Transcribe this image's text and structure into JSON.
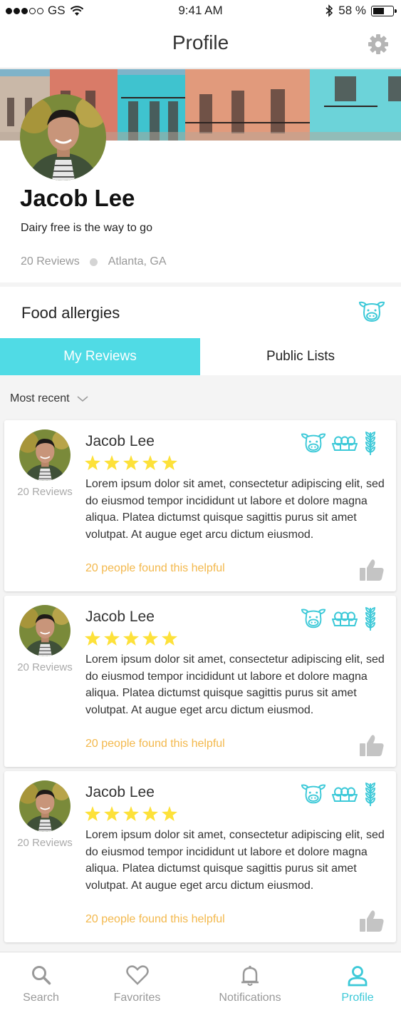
{
  "status_bar": {
    "carrier": "GS",
    "time": "9:41 AM",
    "battery": "58 %",
    "battery_level": 0.58
  },
  "nav": {
    "title": "Profile",
    "settings_icon": "gear-icon"
  },
  "profile": {
    "name": "Jacob Lee",
    "bio": "Dairy free is the way to go",
    "reviews_count": "20 Reviews",
    "location": "Atlanta, GA"
  },
  "allergies": {
    "title": "Food allergies",
    "icon": "cow-icon"
  },
  "tabs": {
    "my_reviews": "My Reviews",
    "public_lists": "Public Lists",
    "active": "my_reviews"
  },
  "sort": {
    "label": "Most recent"
  },
  "colors": {
    "accent": "#50dbe5",
    "icon_accent": "#3cc9d8",
    "star": "#fde13a",
    "helpful": "#f3b84c"
  },
  "reviews": [
    {
      "author": "Jacob Lee",
      "author_reviews": "20 Reviews",
      "rating": 5,
      "icons": [
        "cow-icon",
        "egg-carton-icon",
        "wheat-icon"
      ],
      "text": "Lorem ipsum dolor sit amet, consectetur adipiscing elit, sed do eiusmod tempor incididunt ut labore et dolore magna aliqua. Platea dictumst quisque sagittis purus sit amet volutpat. At augue eget arcu dictum eiusmod.",
      "helpful": "20 people found this helpful"
    },
    {
      "author": "Jacob Lee",
      "author_reviews": "20 Reviews",
      "rating": 5,
      "icons": [
        "cow-icon",
        "egg-carton-icon",
        "wheat-icon"
      ],
      "text": "Lorem ipsum dolor sit amet, consectetur adipiscing elit, sed do eiusmod tempor incididunt ut labore et dolore magna aliqua. Platea dictumst quisque sagittis purus sit amet volutpat. At augue eget arcu dictum eiusmod.",
      "helpful": "20 people found this helpful"
    },
    {
      "author": "Jacob Lee",
      "author_reviews": "20 Reviews",
      "rating": 5,
      "icons": [
        "cow-icon",
        "egg-carton-icon",
        "wheat-icon"
      ],
      "text": "Lorem ipsum dolor sit amet, consectetur adipiscing elit, sed do eiusmod tempor incididunt ut labore et dolore magna aliqua. Platea dictumst quisque sagittis purus sit amet volutpat. At augue eget arcu dictum eiusmod.",
      "helpful": "20 people found this helpful"
    }
  ],
  "tab_bar": {
    "items": [
      {
        "label": "Search",
        "icon": "search-icon"
      },
      {
        "label": "Favorites",
        "icon": "heart-icon"
      },
      {
        "label": "Notifications",
        "icon": "bell-icon"
      },
      {
        "label": "Profile",
        "icon": "person-icon"
      }
    ],
    "active": "Profile"
  }
}
